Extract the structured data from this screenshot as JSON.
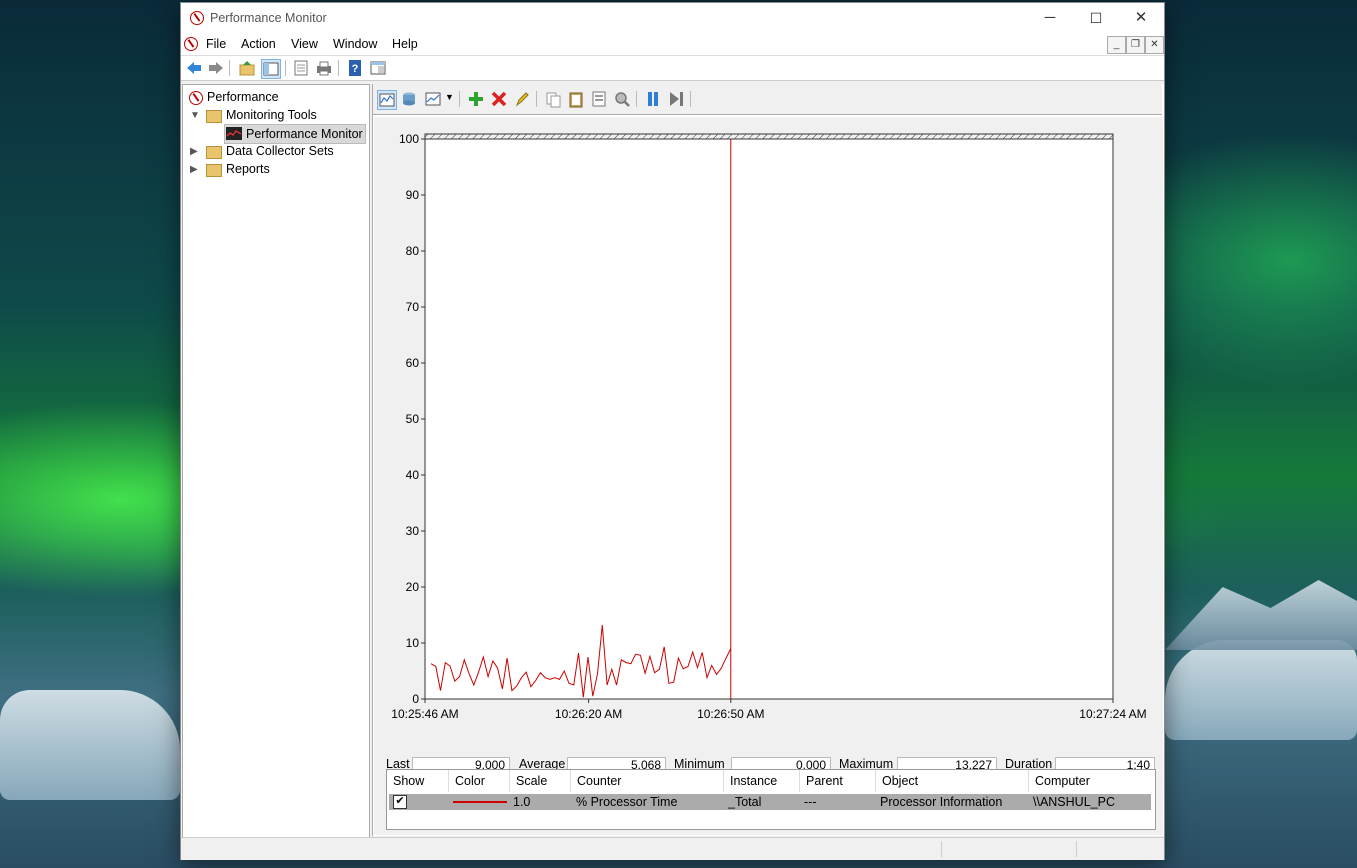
{
  "window": {
    "title": "Performance Monitor",
    "controls": {
      "minimize": "─",
      "maximize": "☐",
      "close": "✕"
    }
  },
  "menu": [
    "File",
    "Action",
    "View",
    "Window",
    "Help"
  ],
  "tree": {
    "root": "Performance",
    "monitoring_tools": "Monitoring Tools",
    "performance_monitor": "Performance Monitor",
    "data_collector_sets": "Data Collector Sets",
    "reports": "Reports"
  },
  "chart_data": {
    "type": "line",
    "ylim": [
      0,
      100
    ],
    "yticks": [
      0,
      10,
      20,
      30,
      40,
      50,
      60,
      70,
      80,
      90,
      100
    ],
    "xtick_labels": [
      "10:25:46 AM",
      "10:26:20 AM",
      "10:26:50 AM",
      "10:27:24 AM"
    ],
    "cursor_sample": 44,
    "total_samples": 100,
    "series": [
      {
        "color": "#cc0000",
        "values": [
          6.3,
          5.8,
          1.5,
          6.5,
          5.9,
          3.2,
          4.0,
          7.0,
          4.5,
          2.5,
          4.8,
          7.5,
          4.0,
          6.8,
          5.5,
          1.8,
          7.3,
          1.5,
          2.3,
          3.8,
          4.8,
          2.2,
          3.3,
          4.7,
          3.8,
          3.5,
          3.8,
          3.5,
          5.0,
          2.8,
          2.5,
          8.2,
          0.3,
          7.5,
          0.5,
          4.5,
          13.2,
          2.5,
          5.3,
          2.5,
          7.0,
          6.5,
          6.3,
          8.0,
          7.8,
          4.6,
          7.6,
          4.7,
          5.3,
          9.3,
          2.8,
          3.0,
          7.3,
          5.4,
          5.8,
          8.4,
          5.6,
          8.3,
          3.8,
          6.0,
          4.4,
          5.5,
          7.3,
          9.0
        ]
      }
    ]
  },
  "stats": {
    "last_label": "Last",
    "last": "9.000",
    "average_label": "Average",
    "average": "5.068",
    "minimum_label": "Minimum",
    "minimum": "0.000",
    "maximum_label": "Maximum",
    "maximum": "13.227",
    "duration_label": "Duration",
    "duration": "1:40"
  },
  "legend": {
    "headers": [
      "Show",
      "Color",
      "Scale",
      "Counter",
      "Instance",
      "Parent",
      "Object",
      "Computer"
    ],
    "rows": [
      {
        "show": "✔",
        "color": "#cc0000",
        "scale": "1.0",
        "counter": "% Processor Time",
        "instance": "_Total",
        "parent": "---",
        "object": "Processor Information",
        "computer": "\\\\ANSHUL_PC"
      }
    ]
  }
}
